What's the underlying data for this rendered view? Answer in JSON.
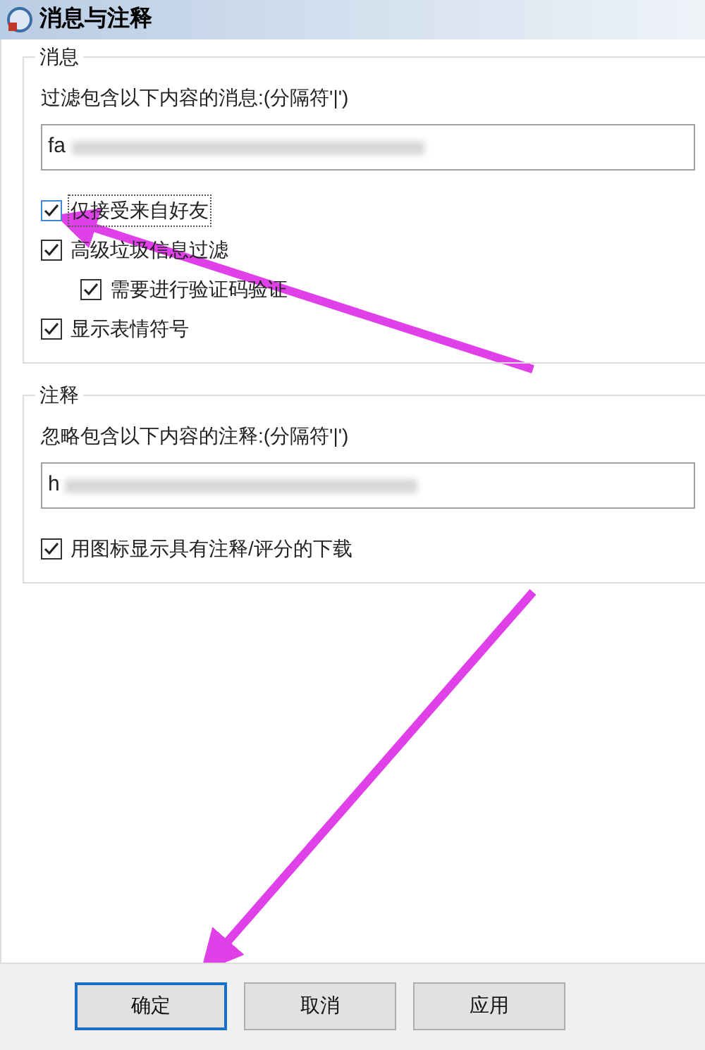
{
  "window": {
    "title": "消息与注释"
  },
  "groups": [
    {
      "title": "消息",
      "field_label": "过滤包含以下内容的消息:(分隔符'|')",
      "field_value": "fa",
      "options": [
        {
          "label": "仅接受来自好友",
          "checked": true,
          "focused": true,
          "indented": false
        },
        {
          "label": "高级垃圾信息过滤",
          "checked": true,
          "focused": false,
          "indented": false
        },
        {
          "label": "需要进行验证码验证",
          "checked": true,
          "focused": false,
          "indented": true
        },
        {
          "label": "显示表情符号",
          "checked": true,
          "focused": false,
          "indented": false
        }
      ]
    },
    {
      "title": "注释",
      "field_label": "忽略包含以下内容的注释:(分隔符'|')",
      "field_value": "h",
      "options": [
        {
          "label": "用图标显示具有注释/评分的下载",
          "checked": true,
          "focused": false,
          "indented": false
        }
      ]
    }
  ],
  "buttons": [
    {
      "label": "确定",
      "default": true
    },
    {
      "label": "取消",
      "default": false
    },
    {
      "label": "应用",
      "default": false
    }
  ]
}
